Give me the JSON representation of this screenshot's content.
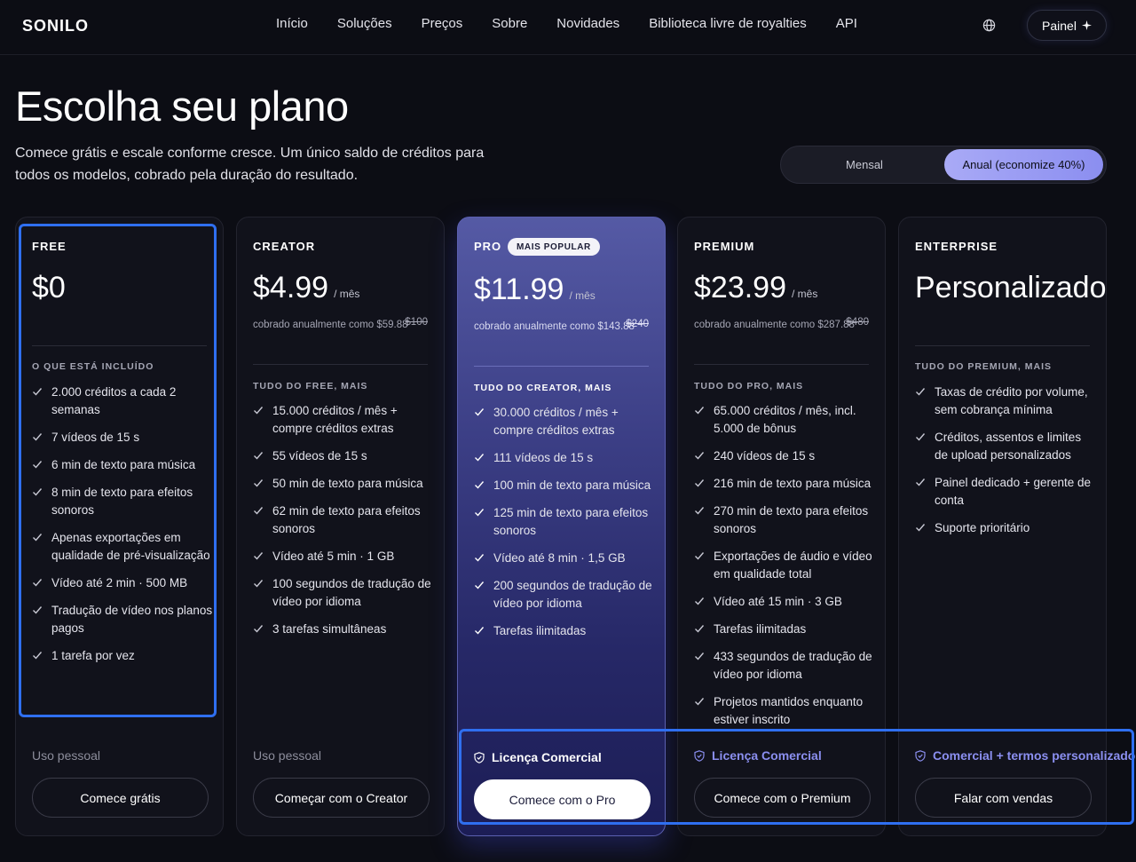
{
  "brand": "SONILO",
  "nav": {
    "links": [
      "Início",
      "Soluções",
      "Preços",
      "Sobre",
      "Novidades",
      "Biblioteca livre de royalties",
      "API"
    ],
    "globe_icon": "globe-icon",
    "dashboard_label": "Painel",
    "dashboard_icon": "sparkle-icon"
  },
  "hero": {
    "title": "Escolha seu plano",
    "subtitle": "Comece grátis e escale conforme cresce. Um único saldo de créditos para todos os modelos, cobrado pela duração do resultado."
  },
  "billing_toggle": {
    "monthly": "Mensal",
    "annual": "Anual (economize 40%)",
    "selected": "annual"
  },
  "plans": [
    {
      "name": "FREE",
      "price": "$0",
      "section_label": "O QUE ESTÁ INCLUÍDO",
      "features": [
        "2.000 créditos a cada 2 semanas",
        "7 vídeos de 15 s",
        "6 min de texto para música",
        "8 min de texto para efeitos sonoros",
        "Apenas exportações em qualidade de pré-visualização",
        "Vídeo até 2 min · 500 MB",
        "Tradução de vídeo nos planos pagos",
        "1 tarefa por vez"
      ],
      "usage": "Uso pessoal",
      "cta": "Comece grátis"
    },
    {
      "name": "CREATOR",
      "price": "$4.99",
      "unit": "/ mês",
      "billed": "cobrado anualmente como $59.88",
      "original": "$100",
      "section_label": "TUDO DO FREE, MAIS",
      "features": [
        "15.000 créditos / mês + compre créditos extras",
        "55 vídeos de 15 s",
        "50 min de texto para música",
        "62 min de texto para efeitos sonoros",
        "Vídeo até 5 min · 1 GB",
        "100 segundos de tradução de vídeo por idioma",
        "3 tarefas simultâneas"
      ],
      "usage": "Uso pessoal",
      "cta": "Começar com o Creator"
    },
    {
      "name": "PRO",
      "badge": "MAIS POPULAR",
      "price": "$11.99",
      "unit": "/ mês",
      "billed": "cobrado anualmente como $143.88",
      "original": "$240",
      "section_label": "TUDO DO CREATOR, MAIS",
      "features": [
        "30.000 créditos / mês + compre créditos extras",
        "111 vídeos de 15 s",
        "100 min de texto para música",
        "125 min de texto para efeitos sonoros",
        "Vídeo até 8 min · 1,5 GB",
        "200 segundos de tradução de vídeo por idioma",
        "Tarefas ilimitadas"
      ],
      "license": "Licença Comercial",
      "cta": "Comece com o Pro"
    },
    {
      "name": "PREMIUM",
      "price": "$23.99",
      "unit": "/ mês",
      "billed": "cobrado anualmente como $287.88",
      "original": "$480",
      "section_label": "TUDO DO PRO, MAIS",
      "features": [
        "65.000 créditos / mês, incl. 5.000 de bônus",
        "240 vídeos de 15 s",
        "216 min de texto para música",
        "270 min de texto para efeitos sonoros",
        "Exportações de áudio e vídeo em qualidade total",
        "Vídeo até 15 min · 3 GB",
        "Tarefas ilimitadas",
        "433 segundos de tradução de vídeo por idioma",
        "Projetos mantidos enquanto estiver inscrito"
      ],
      "license": "Licença Comercial",
      "cta": "Comece com o Premium"
    },
    {
      "name": "ENTERPRISE",
      "price": "Personalizado",
      "section_label": "TUDO DO PREMIUM, MAIS",
      "features": [
        "Taxas de crédito por volume, sem cobrança mínima",
        "Créditos, assentos e limites de upload personalizados",
        "Painel dedicado + gerente de conta",
        "Suporte prioritário"
      ],
      "license": "Comercial + termos personalizados",
      "cta": "Falar com vendas"
    }
  ],
  "colors": {
    "background": "#0c0d14",
    "accent": "#8b8ff0",
    "highlight": "#2f6ff0"
  }
}
